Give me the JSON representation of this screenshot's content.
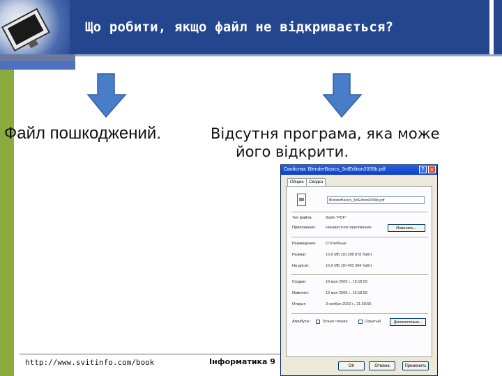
{
  "header": {
    "title": "Що робити, якщо файл не відкривається?"
  },
  "left_column": {
    "text": "Файл пошкоджений."
  },
  "right_column": {
    "line1": "Відсутня програма, яка може",
    "line2": "його відкрити."
  },
  "footer": {
    "url": "http://www.svitinfo.com/book",
    "subject": "Інформатика 9"
  },
  "dialog": {
    "title": "Свойства: BlenderBasics_3rdEdition2009b.pdf",
    "tabs": [
      "Общие",
      "Сводка"
    ],
    "file_name": "BlenderBasics_3rdEdition2009b.pdf",
    "rows1": [
      {
        "label": "Тип файла:",
        "value": "Файл \"PDF\""
      },
      {
        "label": "Приложение:",
        "value": "Неизвестное приложение"
      }
    ],
    "change_button": "Изменить...",
    "rows2": [
      {
        "label": "Размещение:",
        "value": "D:\\Учебные"
      },
      {
        "label": "Размер:",
        "value": "15,6 МБ (16 398 878 байт)"
      },
      {
        "label": "На диске:",
        "value": "15,6 МБ (16 400 384 байт)"
      }
    ],
    "rows3": [
      {
        "label": "Создан:",
        "value": "19 мая 2009 г., 15:18:55"
      },
      {
        "label": "Изменен:",
        "value": "19 мая 2009 г., 15:18:55"
      },
      {
        "label": "Открыт:",
        "value": "3 ноября 2010 г., 21:28:55"
      }
    ],
    "attributes_label": "Атрибуты:",
    "readonly_label": "Только чтение",
    "hidden_label": "Скрытый",
    "advanced_button": "Дополнительно...",
    "buttons": [
      "OK",
      "Отмена",
      "Применить"
    ]
  },
  "colors": {
    "header_bg": "#24468f",
    "sidebar": "#8cab3f",
    "arrow": "#4a7dc8"
  }
}
